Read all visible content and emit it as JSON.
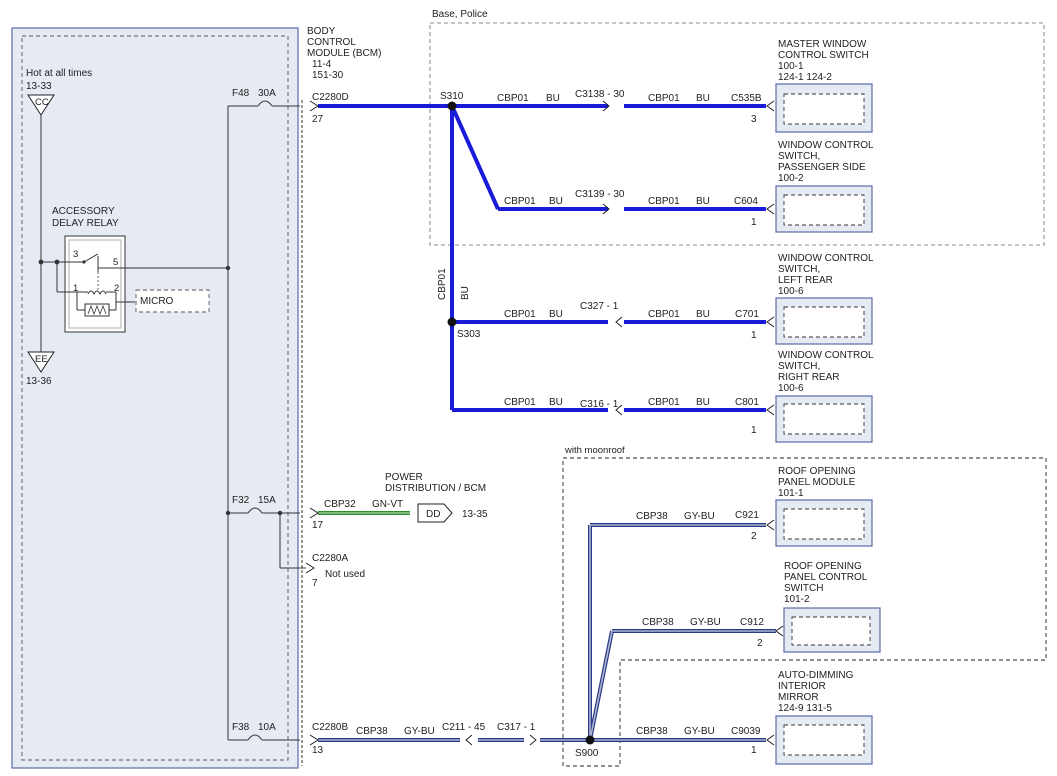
{
  "colors": {
    "bu_wire": "#1a1ad9",
    "gn_vt_wire": "#2e8b2e",
    "gy_bu_wire": "#8a93ad",
    "panel_fill": "#e6ebf3",
    "panel_border": "#5a6aa8",
    "connector_fill": "#dfe4ec"
  },
  "fuse_box": {
    "hot_label": "Hot at all times",
    "hot_ref": "13-33",
    "cc_label": "CC",
    "ee_label": "EE",
    "ee_ref": "13-36",
    "relay_title_1": "ACCESSORY",
    "relay_title_2": "DELAY RELAY",
    "relay_pin_3": "3",
    "relay_pin_5": "5",
    "relay_pin_1": "1",
    "relay_pin_2": "2",
    "micro_label": "MICRO",
    "fuses": [
      {
        "name": "F48",
        "rating": "30A"
      },
      {
        "name": "F32",
        "rating": "15A"
      },
      {
        "name": "F38",
        "rating": "10A"
      }
    ]
  },
  "bcm": {
    "line1": "BODY",
    "line2": "CONTROL",
    "line3": "MODULE (BCM)",
    "ref1": "11-4",
    "ref2": "151-30",
    "conn_d": "C2280D",
    "pin_27": "27",
    "pin_17": "17",
    "conn_a": "C2280A",
    "not_used": "Not used",
    "pin_7": "7",
    "conn_b": "C2280B",
    "pin_13": "13"
  },
  "base_police_label": "Base, Police",
  "moonroof_label": "with moonroof",
  "wires": {
    "cbp01": "CBP01",
    "bu": "BU",
    "cbp32": "CBP32",
    "gn_vt": "GN-VT",
    "cbp38": "CBP38",
    "gy_bu": "GY-BU"
  },
  "splices": {
    "s310": "S310",
    "s303": "S303",
    "s900": "S900"
  },
  "inline": {
    "c3138": "C3138 - 30",
    "c3139": "C3139 - 30",
    "c327": "C327 - 1",
    "c316": "C316 - 1",
    "c211": "C211 - 45",
    "c317": "C317 - 1"
  },
  "power_dist": {
    "line1": "POWER",
    "line2": "DISTRIBUTION / BCM",
    "dd": "DD",
    "ref": "13-35"
  },
  "components": [
    {
      "l1": "MASTER WINDOW",
      "l2": "CONTROL SWITCH",
      "l3": "100-1",
      "l4": "124-1      124-2",
      "conn": "C535B",
      "pin": "3"
    },
    {
      "l1": "WINDOW CONTROL",
      "l2": "SWITCH,",
      "l3": "PASSENGER SIDE",
      "l4": "100-2",
      "conn": "C604",
      "pin": "1"
    },
    {
      "l1": "WINDOW CONTROL",
      "l2": "SWITCH,",
      "l3": "LEFT REAR",
      "l4": "100-6",
      "conn": "C701",
      "pin": "1"
    },
    {
      "l1": "WINDOW CONTROL",
      "l2": "SWITCH,",
      "l3": "RIGHT REAR",
      "l4": "100-6",
      "conn": "C801",
      "pin": "1"
    },
    {
      "l1": "ROOF OPENING",
      "l2": "PANEL MODULE",
      "l3": "101-1",
      "l4": "",
      "conn": "C921",
      "pin": "2"
    },
    {
      "l1": "ROOF OPENING",
      "l2": "PANEL CONTROL",
      "l3": "SWITCH",
      "l4": "101-2",
      "conn": "C912",
      "pin": "2"
    },
    {
      "l1": "AUTO-DIMMING",
      "l2": "INTERIOR",
      "l3": "MIRROR",
      "l4": "124-9      131-5",
      "conn": "C9039",
      "pin": "1"
    }
  ]
}
